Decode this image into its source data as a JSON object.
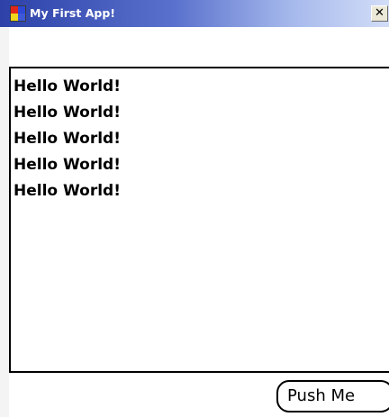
{
  "window": {
    "title": "My First App!",
    "close_glyph": "✕",
    "icon": "app-window-icon"
  },
  "output": {
    "lines": [
      "Hello World!",
      "Hello World!",
      "Hello World!",
      "Hello World!",
      "Hello World!"
    ]
  },
  "actions": {
    "push_label": "Push Me"
  },
  "colors": {
    "titlebar_start": "#2d41a8",
    "titlebar_end": "#d2ddf7",
    "text": "#000000",
    "background": "#ffffff"
  }
}
